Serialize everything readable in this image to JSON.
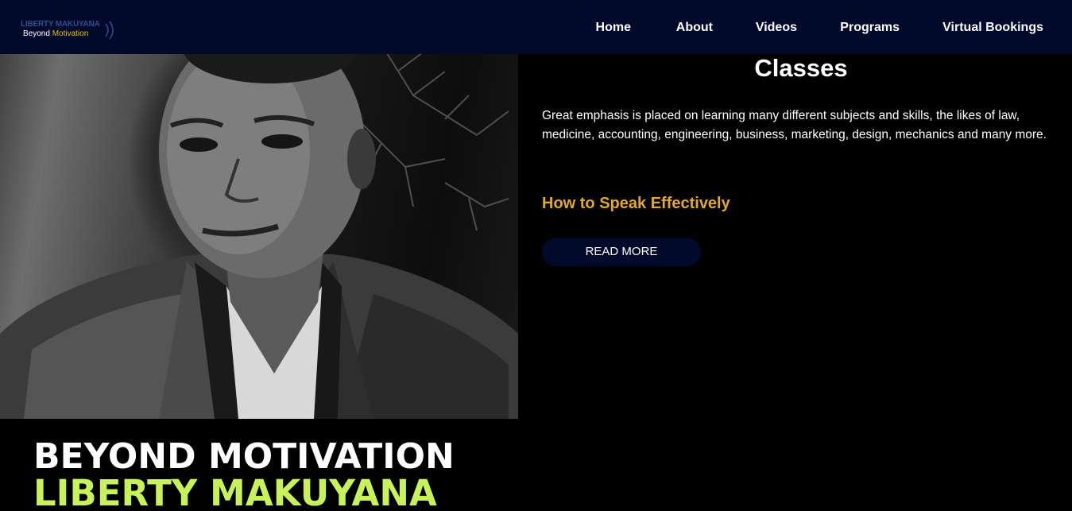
{
  "header": {
    "logo": {
      "name": "LIBERTY MAKUYANA",
      "tagline_main": "Beyond",
      "tagline_accent": "Motivation"
    },
    "nav": [
      {
        "label": "Home"
      },
      {
        "label": "About"
      },
      {
        "label": "Videos"
      },
      {
        "label": "Programs"
      },
      {
        "label": "Virtual Bookings"
      }
    ]
  },
  "hero": {
    "banner_line1": "BEYOND MOTIVATION",
    "banner_line2": "LIBERTY MAKUYANA"
  },
  "main": {
    "section_title": "Classes",
    "description": "Great emphasis is placed on learning many different subjects and skills, the likes of law, medicine, accounting, engineering, business, marketing, design, mechanics and many more.",
    "item_title": "How to Speak Effectively",
    "read_more_label": "READ MORE"
  },
  "colors": {
    "header_bg": "#020a2b",
    "accent_gold": "#e0a82e",
    "banner_green": "#c8f25a",
    "page_bg": "#000000"
  },
  "icons": [
    "sound-wave-icon"
  ]
}
